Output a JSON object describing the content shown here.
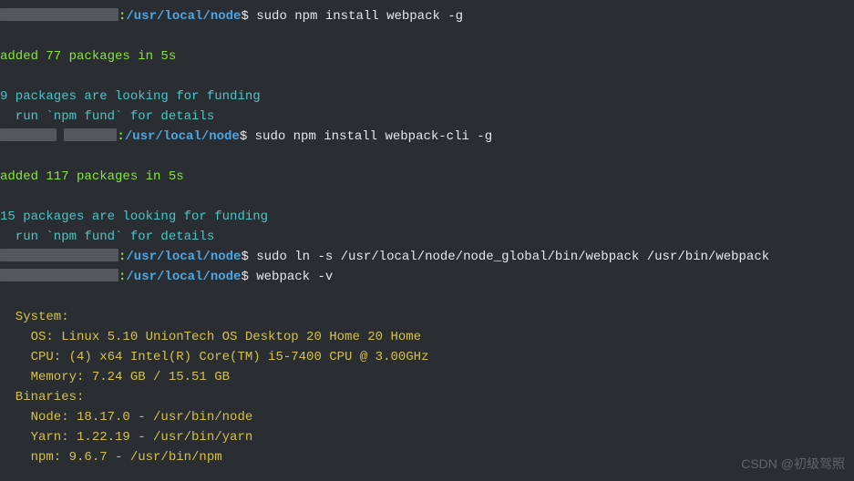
{
  "prompt": {
    "colon": ":",
    "path": "/usr/local/node",
    "symbol": "$"
  },
  "commands": {
    "cmd1": " sudo npm install webpack -g",
    "cmd2": " sudo npm install webpack-cli -g",
    "cmd3": " sudo ln -s /usr/local/node/node_global/bin/webpack /usr/bin/webpack",
    "cmd4": " webpack -v"
  },
  "output": {
    "added1": "added 77 packages in 5s",
    "funding1a": "9 packages are looking for funding",
    "funding1b": "  run `npm fund` for details",
    "added2": "added 117 packages in 5s",
    "funding2a": "15 packages are looking for funding",
    "funding2b": "  run `npm fund` for details",
    "system_header": "  System:",
    "system_os": "    OS: Linux 5.10 UnionTech OS Desktop 20 Home 20 Home",
    "system_cpu": "    CPU: (4) x64 Intel(R) Core(TM) i5-7400 CPU @ 3.00GHz",
    "system_memory": "    Memory: 7.24 GB / 15.51 GB",
    "binaries_header": "  Binaries:",
    "binaries_node": "    Node: 18.17.0 - /usr/bin/node",
    "binaries_yarn": "    Yarn: 1.22.19 - /usr/bin/yarn",
    "binaries_npm": "    npm: 9.6.7 - /usr/bin/npm"
  },
  "watermark": "CSDN @初级驾照"
}
